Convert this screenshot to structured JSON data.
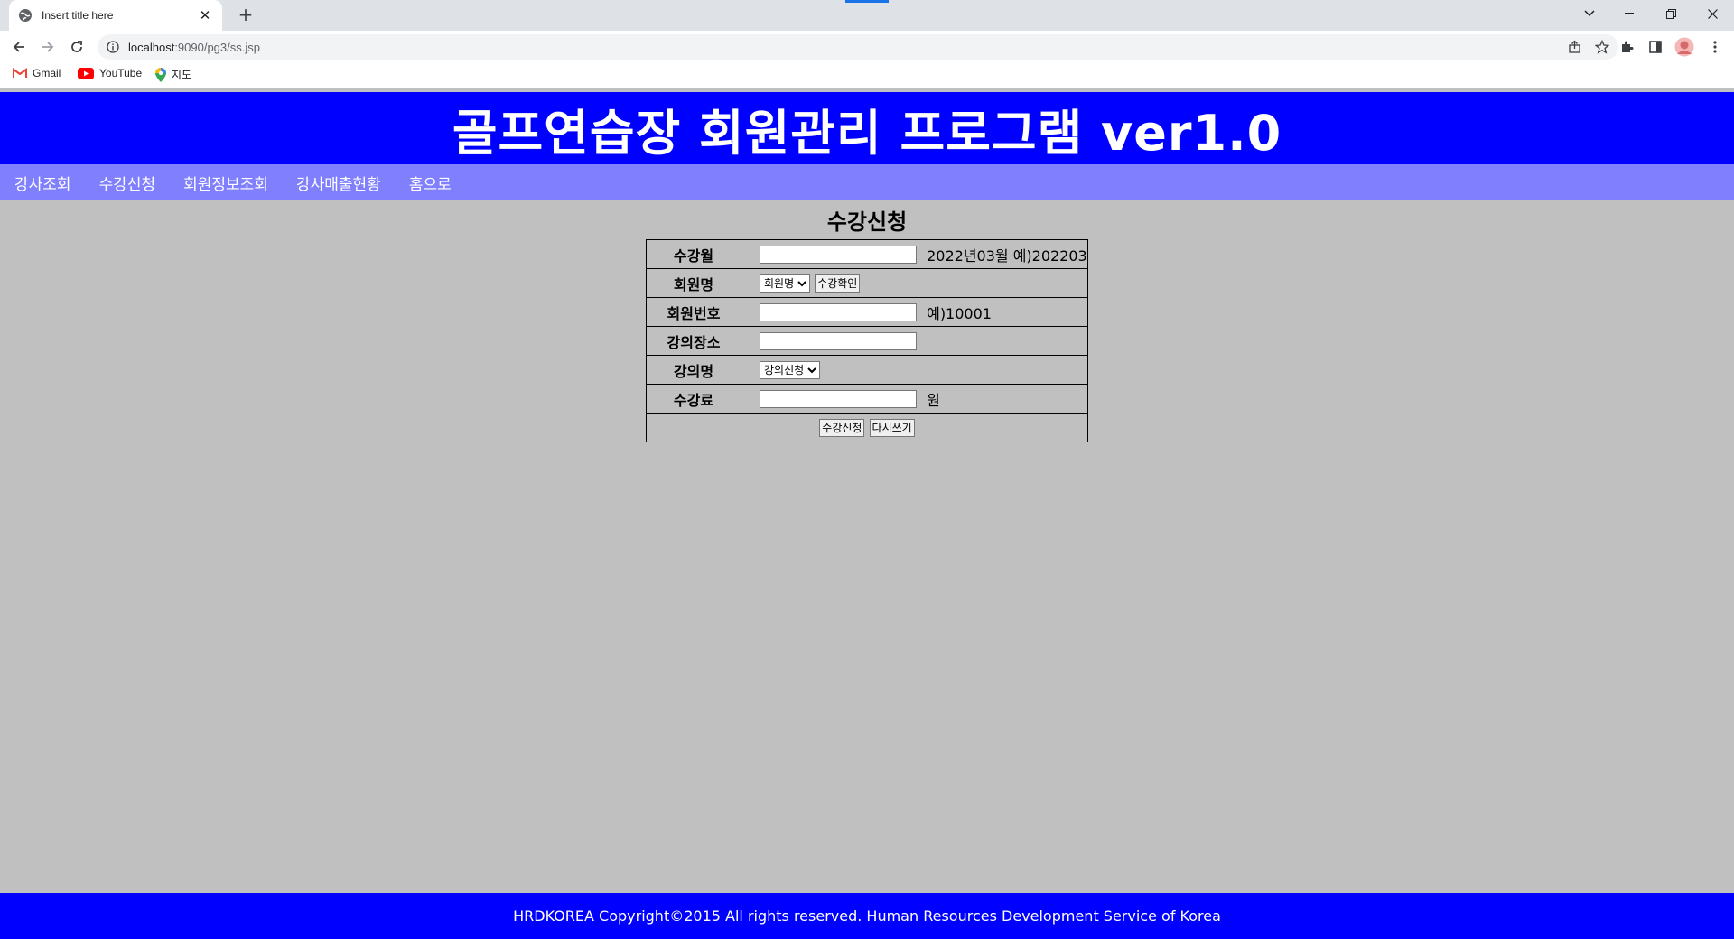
{
  "browser": {
    "tab_title": "Insert title here",
    "tab_close": "✕",
    "new_tab": "+",
    "url_host": "localhost",
    "url_path": ":9090/pg3/ss.jsp",
    "bookmarks": [
      {
        "label": "Gmail"
      },
      {
        "label": "YouTube"
      },
      {
        "label": "지도"
      }
    ]
  },
  "page": {
    "header_title": "골프연습장 회원관리 프로그램 ver1.0",
    "nav": [
      {
        "label": "강사조회"
      },
      {
        "label": "수강신청"
      },
      {
        "label": "회원정보조회"
      },
      {
        "label": "강사매출현황"
      },
      {
        "label": "홈으로"
      }
    ],
    "section_title": "수강신청",
    "form": {
      "month_label": "수강월",
      "month_value": "",
      "month_hint": "2022년03월 예)202203",
      "member_name_label": "회원명",
      "member_name_selected": "회원명",
      "confirm_button": "수강확인",
      "member_no_label": "회원번호",
      "member_no_value": "",
      "member_no_hint": "예)10001",
      "place_label": "강의장소",
      "place_value": "",
      "class_label": "강의명",
      "class_selected": "강의신청",
      "fee_label": "수강료",
      "fee_value": "",
      "fee_unit": "원",
      "submit_button": "수강신청",
      "reset_button": "다시쓰기"
    },
    "footer_text": "HRDKOREA Copyright©2015 All rights reserved. Human Resources Development Service of Korea"
  },
  "colors": {
    "header_bg": "#0000ff",
    "nav_bg": "#8080ff",
    "page_bg": "#c0c0c0"
  }
}
